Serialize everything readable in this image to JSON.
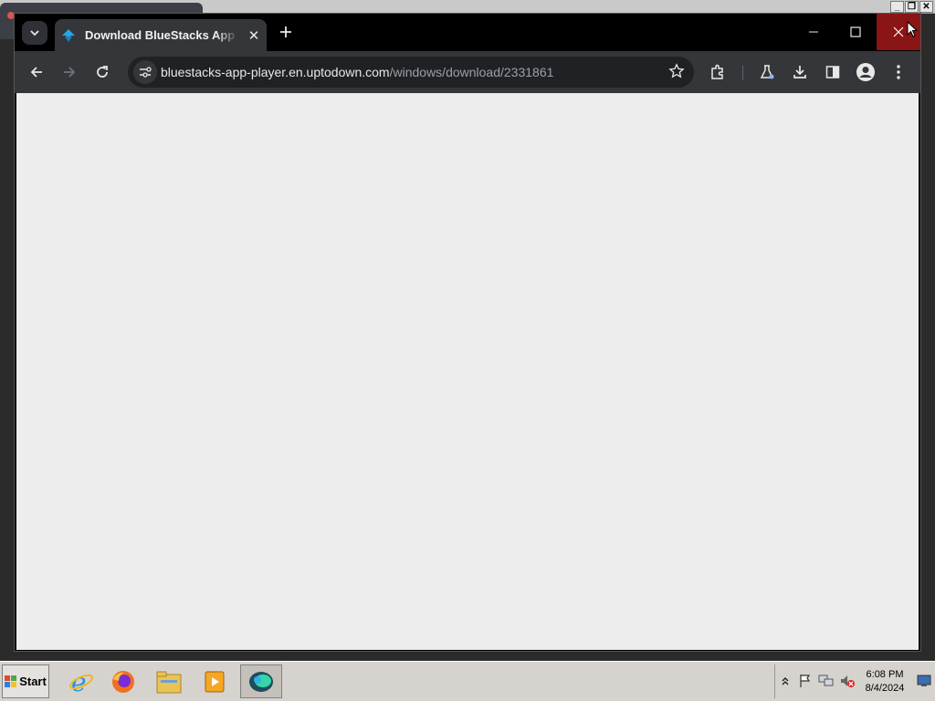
{
  "browser": {
    "tab": {
      "title": "Download BlueStacks App Player",
      "favicon": "uptodown-arrow-icon",
      "close_icon": "close-icon"
    },
    "new_tab_icon": "plus-icon",
    "window_controls": [
      "minimize-icon",
      "maximize-icon",
      "close-icon"
    ],
    "url": {
      "domain": "bluestacks-app-player.en.uptodown.com",
      "path": "/windows/download/2331861"
    },
    "toolbar_icons": [
      "back-icon",
      "forward-icon",
      "reload-icon",
      "site-info-icon",
      "star-icon",
      "extensions-icon",
      "labs-icon",
      "download-icon",
      "side-panel-icon",
      "profile-icon",
      "menu-icon"
    ]
  },
  "taskbar": {
    "start_label": "Start",
    "apps": [
      "internet-explorer-icon",
      "firefox-icon",
      "file-explorer-icon",
      "media-player-icon",
      "bluestacks-icon"
    ],
    "clock": {
      "time": "6:08 PM",
      "date": "8/4/2024"
    }
  },
  "colors": {
    "titlebar": "#000000",
    "toolbar": "#35363a",
    "close_hover": "#8b1414",
    "content": "#ededed",
    "taskbar": "#d6d3ce"
  }
}
